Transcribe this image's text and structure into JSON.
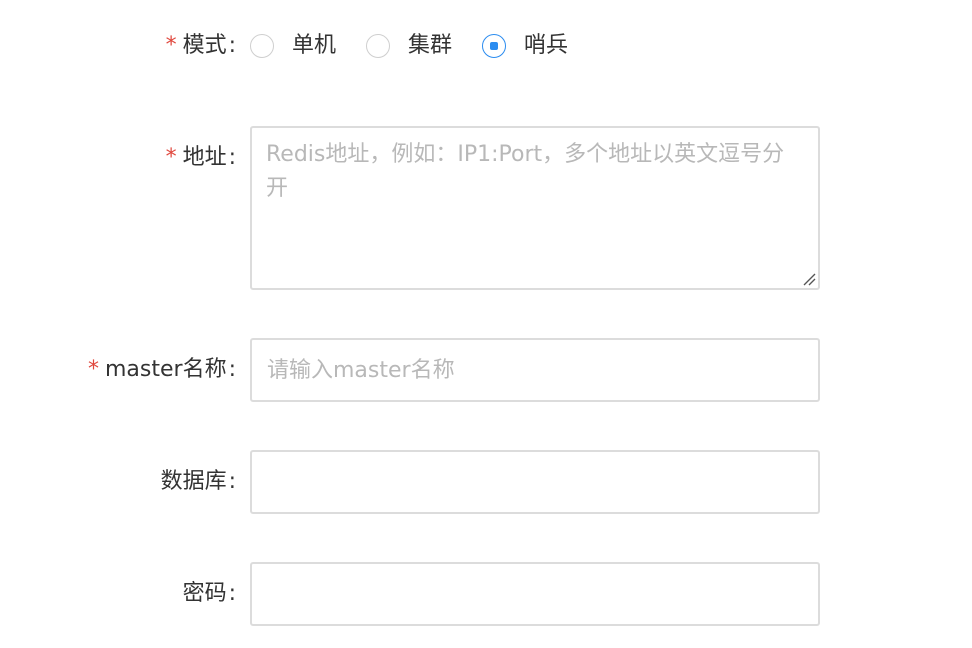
{
  "form": {
    "mode": {
      "required_mark": "*",
      "label": "模式",
      "colon": ":",
      "options": [
        "单机",
        "集群",
        "哨兵"
      ],
      "selected": "哨兵"
    },
    "address": {
      "required_mark": "*",
      "label": "地址",
      "colon": ":",
      "placeholder": "Redis地址，例如：IP1:Port，多个地址以英文逗号分开"
    },
    "master_name": {
      "required_mark": "*",
      "label": "master名称",
      "colon": ":",
      "placeholder": "请输入master名称",
      "value": ""
    },
    "database": {
      "label": "数据库",
      "colon": ":",
      "value": ""
    },
    "password": {
      "label": "密码",
      "colon": ":",
      "value": ""
    }
  },
  "colors": {
    "accent": "#2b8cf0",
    "required": "#e0483e",
    "border": "#dcdcdc",
    "placeholder": "#b8b8b8"
  }
}
